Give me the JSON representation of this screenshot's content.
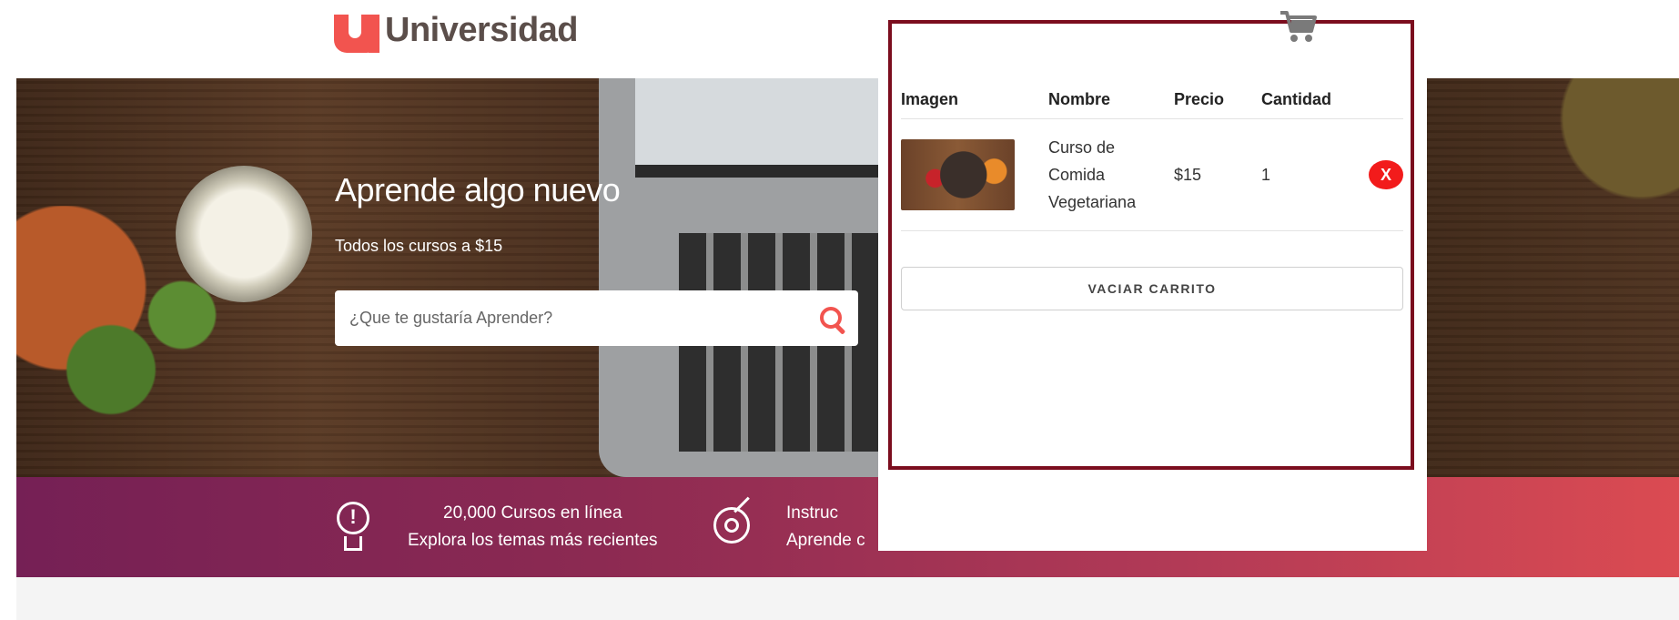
{
  "header": {
    "logo_text": "Universidad",
    "cart_icon": "cart-icon"
  },
  "hero": {
    "title": "Aprende algo nuevo",
    "subtitle": "Todos los cursos a $15",
    "search_placeholder": "¿Que te gustaría Aprender?",
    "search_icon": "search-icon"
  },
  "features": [
    {
      "icon": "lightbulb-icon",
      "line1": "20,000 Cursos en línea",
      "line2": "Explora los temas más recientes"
    },
    {
      "icon": "target-icon",
      "line1": "Instruc",
      "line2": "Aprende c"
    }
  ],
  "cart": {
    "columns": [
      "Imagen",
      "Nombre",
      "Precio",
      "Cantidad"
    ],
    "items": [
      {
        "image": "vegetables-course-thumbnail",
        "name_lines": [
          "Curso de",
          "Comida",
          "Vegetariana"
        ],
        "price": "$15",
        "quantity": "1",
        "remove_label": "X"
      }
    ],
    "empty_label": "VACIAR CARRITO"
  },
  "colors": {
    "brand_red": "#f2544f",
    "frame_dark_red": "#7b0d1e",
    "remove_red": "#f21b1b",
    "band_start": "#752055",
    "band_end": "#db4b52"
  }
}
